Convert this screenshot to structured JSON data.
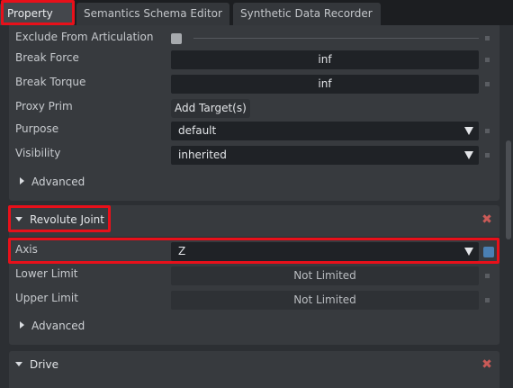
{
  "tabs": [
    {
      "label": "Property"
    },
    {
      "label": "Semantics Schema Editor"
    },
    {
      "label": "Synthetic Data Recorder"
    }
  ],
  "physics": {
    "exclude_from_articulation": {
      "label": "Exclude From Articulation",
      "checked": false
    },
    "break_force": {
      "label": "Break Force",
      "value": "inf"
    },
    "break_torque": {
      "label": "Break Torque",
      "value": "inf"
    },
    "proxy_prim": {
      "label": "Proxy Prim",
      "button": "Add Target(s)"
    },
    "purpose": {
      "label": "Purpose",
      "value": "default"
    },
    "visibility": {
      "label": "Visibility",
      "value": "inherited"
    },
    "advanced": "Advanced"
  },
  "revolute_joint": {
    "title": "Revolute Joint",
    "axis": {
      "label": "Axis",
      "value": "Z"
    },
    "lower_limit": {
      "label": "Lower Limit",
      "value": "Not Limited"
    },
    "upper_limit": {
      "label": "Upper Limit",
      "value": "Not Limited"
    },
    "advanced": "Advanced"
  },
  "drive": {
    "title": "Drive"
  },
  "colors": {
    "highlight": "#e8101a",
    "remove": "#c95a57",
    "accent": "#4a7fb3"
  }
}
